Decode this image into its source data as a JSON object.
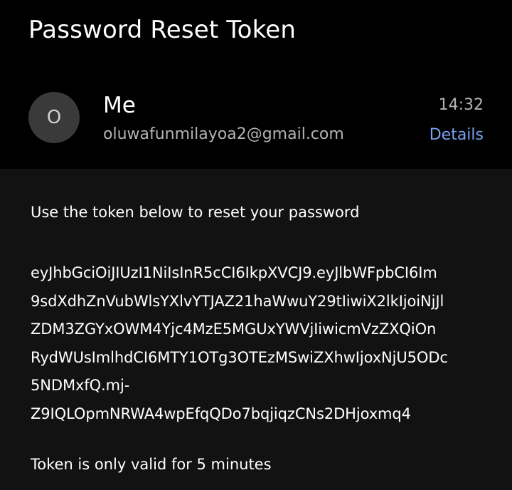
{
  "email": {
    "subject": "Password Reset Token",
    "sender": {
      "avatar_initial": "O",
      "name": "Me",
      "email": "oluwafunmilayoa2@gmail.com"
    },
    "time": "14:32",
    "details_label": "Details"
  },
  "body": {
    "intro": "Use the token below to reset your password",
    "token_lines": [
      "eyJhbGciOiJIUzI1NiIsInR5cCI6IkpXVCJ9.eyJlbWFpbCI6Im",
      "9sdXdhZnVubWlsYXlvYTJAZ21haWwuY29tIiwiX2lkIjoiNjJl",
      "ZDM3ZGYxOWM4Yjc4MzE5MGUxYWVjIiwicmVzZXQiOn",
      "RydWUsImlhdCI6MTY1OTg3OTEzMSwiZXhwIjoxNjU5ODc",
      "5NDMxfQ.mj-",
      "Z9IQLOpmNRWA4wpEfqQDo7bqjiqzCNs2DHjoxmq4"
    ],
    "validity": "Token is only valid for 5 minutes"
  }
}
